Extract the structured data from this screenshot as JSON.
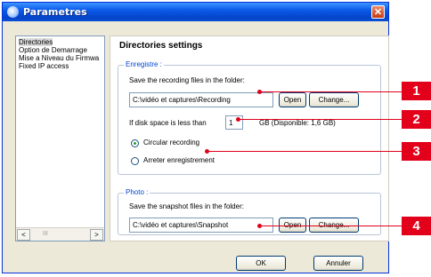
{
  "window": {
    "title": "Parametres",
    "close_glyph": "✕"
  },
  "sidebar": {
    "items": [
      {
        "label": "Directories",
        "selected": true
      },
      {
        "label": "Option de Demarrage",
        "selected": false
      },
      {
        "label": "Mise a Niveau du Firmwa",
        "selected": false
      },
      {
        "label": "Fixed IP access",
        "selected": false
      }
    ],
    "scroll_left": "<",
    "scroll_right": ">",
    "scroll_thumb": "III"
  },
  "panel": {
    "title": "Directories settings",
    "enregistre": {
      "legend": "Enregistre :",
      "folder_prompt": "Save the recording files in the folder:",
      "folder_value": "C:\\vidéo et captures\\Recording",
      "open_label": "Open",
      "change_label": "Change...",
      "disk_prefix": "If disk space is less than",
      "disk_value": "1",
      "disk_suffix": "GB (Disponible: 1,6 GB)",
      "radio_circular": "Circular recording",
      "radio_stop": "Arreter enregistrement",
      "selected_radio": "circular"
    },
    "photo": {
      "legend": "Photo :",
      "folder_prompt": "Save the snapshot files in the folder:",
      "folder_value": "C:\\vidéo et captures\\Snapshot",
      "open_label": "Open",
      "change_label": "Change..."
    }
  },
  "buttons": {
    "ok": "OK",
    "cancel": "Annuler"
  },
  "callouts": [
    "1",
    "2",
    "3",
    "4"
  ],
  "colors": {
    "callout_red": "#e2001a",
    "title_blue": "#0a5ae8"
  }
}
